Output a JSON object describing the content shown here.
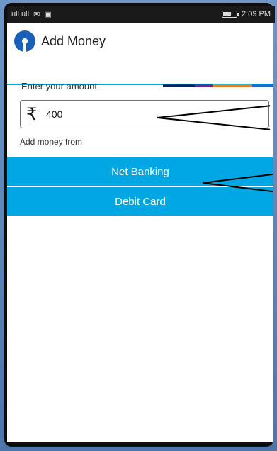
{
  "status_bar": {
    "signal_text": "ull ull",
    "time": "2:09 PM"
  },
  "app": {
    "title": "Add Money"
  },
  "form": {
    "amount_label": "Enter your amount",
    "currency_symbol": "₹",
    "amount_value": "400",
    "add_from_label": "Add money from"
  },
  "buttons": [
    {
      "label": "Net Banking"
    },
    {
      "label": "Debit Card"
    }
  ],
  "colors": {
    "accent": "#00a7e2",
    "logo": "#1b60b8"
  }
}
